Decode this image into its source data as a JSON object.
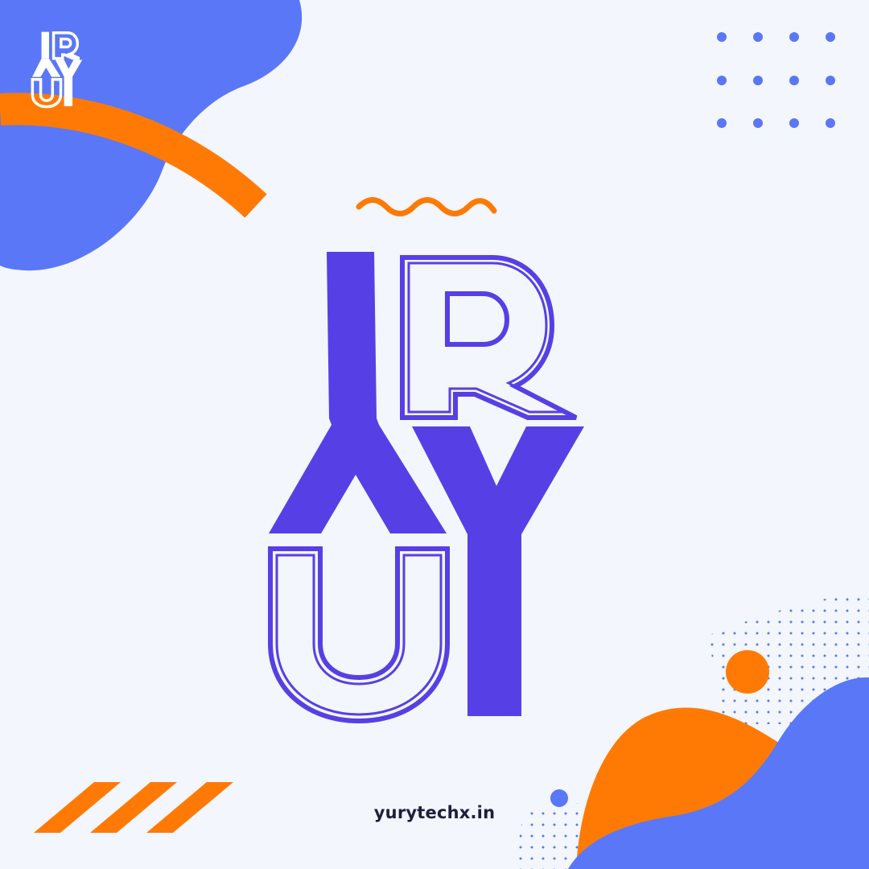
{
  "brand": {
    "mark": "RYU",
    "website": "yurytechx.in"
  },
  "colors": {
    "background": "#f3f6fc",
    "blue_blob": "#5a77f7",
    "orange": "#ff7a05",
    "logo_purple": "#573fe6",
    "logo_white": "#ffffff",
    "text": "#1e1e3c"
  },
  "icons": [
    "dot-grid",
    "wave-squiggle",
    "diagonal-stripes",
    "blob-shape",
    "arc-stroke"
  ]
}
